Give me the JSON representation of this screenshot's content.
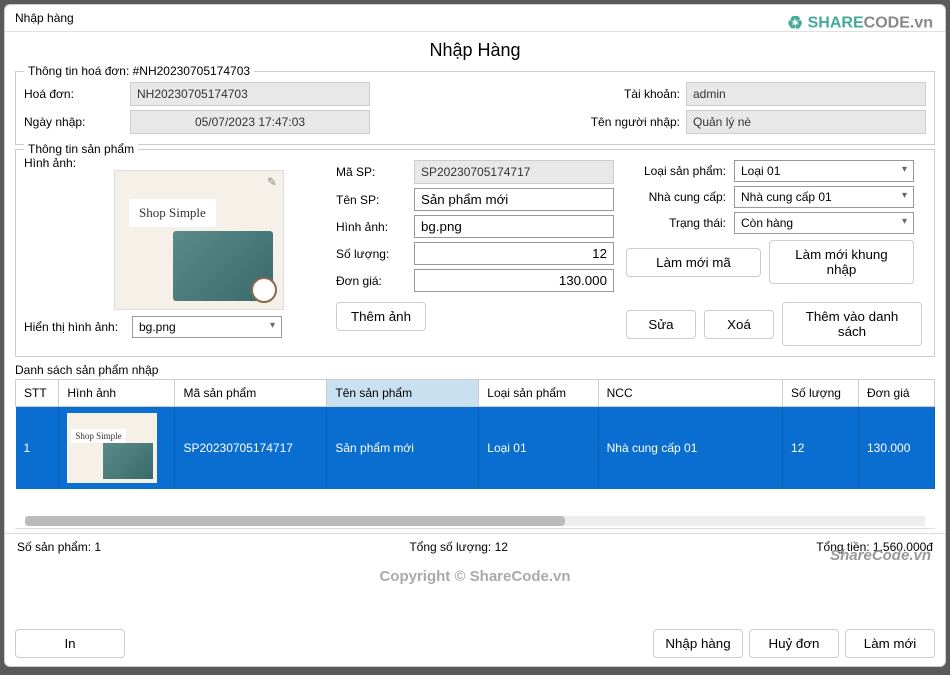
{
  "window_title": "Nhập hàng",
  "watermark_top": {
    "share": "SHARE",
    "code": "CODE",
    "suffix": ".vn"
  },
  "page_title": "Nhập Hàng",
  "invoice": {
    "legend": "Thông tin hoá đơn: #NH20230705174703",
    "labels": {
      "invoice": "Hoá đơn:",
      "date": "Ngày nhập:",
      "account": "Tài khoản:",
      "user": "Tên người nhập:"
    },
    "values": {
      "invoice": "NH20230705174703",
      "date": "05/07/2023 17:47:03",
      "account": "admin",
      "user": "Quản lý nè"
    }
  },
  "product": {
    "legend": "Thông tin sản phẩm",
    "labels": {
      "image": "Hình ảnh:",
      "show_image": "Hiển thị hình ảnh:",
      "code": "Mã SP:",
      "name": "Tên SP:",
      "img_field": "Hình ảnh:",
      "qty": "Số lượng:",
      "price": "Đơn giá:",
      "type": "Loại sản phẩm:",
      "supplier": "Nhà cung cấp:",
      "status": "Trạng thái:"
    },
    "values": {
      "code": "SP20230705174717",
      "name": "Sản phẩm mới",
      "img": "bg.png",
      "qty": "12",
      "price": "130.000",
      "show_image_sel": "bg.png",
      "type": "Loại 01",
      "supplier": "Nhà cung cấp 01",
      "status": "Còn hàng"
    },
    "thumb_text": "Shop Simple",
    "buttons": {
      "refresh_code": "Làm mới mã",
      "refresh_frame": "Làm mới khung nhập",
      "add_img": "Thêm ảnh",
      "edit": "Sửa",
      "delete": "Xoá",
      "add_list": "Thêm vào danh sách"
    }
  },
  "list": {
    "legend": "Danh sách sản phẩm nhập",
    "headers": {
      "stt": "STT",
      "img": "Hình ảnh",
      "code": "Mã sản phẩm",
      "name": "Tên sản phẩm",
      "type": "Loại sản phẩm",
      "supplier": "NCC",
      "qty": "Số lượng",
      "price": "Đơn giá"
    },
    "rows": [
      {
        "stt": "1",
        "code": "SP20230705174717",
        "name": "Sản phẩm mới",
        "type": "Loại 01",
        "supplier": "Nhà cung cấp 01",
        "qty": "12",
        "price": "130.000",
        "thumb_text": "Shop Simple"
      }
    ]
  },
  "summary": {
    "count_label": "Số sản phẩm:",
    "count": "1",
    "qty_label": "Tổng số lượng:",
    "qty": "12",
    "total_label": "Tổng tiền:",
    "total": "1.560.000đ"
  },
  "watermark_lower": "ShareCode.vn",
  "footer_copy": "Copyright © ShareCode.vn",
  "footer_buttons": {
    "print": "In",
    "import": "Nhập hàng",
    "cancel": "Huỷ đơn",
    "refresh": "Làm mới"
  }
}
